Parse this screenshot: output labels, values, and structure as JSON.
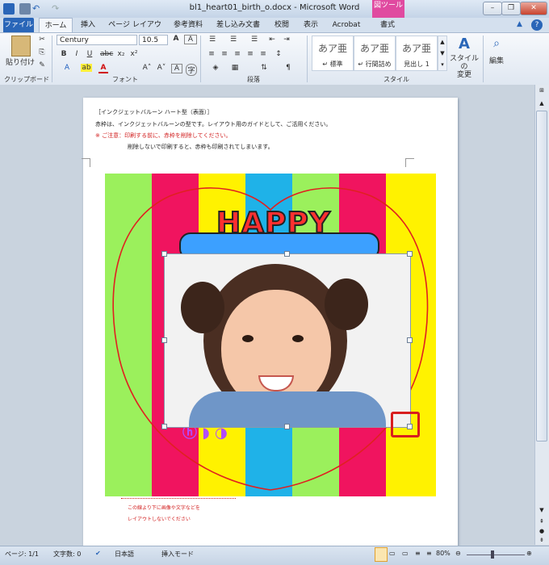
{
  "window": {
    "title": "bl1_heart01_birth_o.docx - Microsoft Word",
    "context_tab": "図ツール",
    "accent": "#2a66b8"
  },
  "tabs": [
    "ファイル",
    "ホーム",
    "挿入",
    "ページ レイアウト",
    "参考資料",
    "差し込み文書",
    "校閲",
    "表示",
    "Acrobat",
    "書式"
  ],
  "ribbon": {
    "clipboard": {
      "label": "クリップボード",
      "paste": "貼り付け"
    },
    "font": {
      "label": "フォント",
      "name": "Century",
      "size": "10.5"
    },
    "paragraph": {
      "label": "段落"
    },
    "styles": {
      "label": "スタイル",
      "items": [
        {
          "glyph": "あア亜",
          "name": "↵ 標準"
        },
        {
          "glyph": "あア亜",
          "name": "↵ 行間詰め"
        },
        {
          "glyph": "あア亜",
          "name": "見出し 1"
        }
      ],
      "change": "スタイルの\n変更"
    },
    "edit": {
      "label": "編集"
    }
  },
  "document": {
    "lines": [
      {
        "text": "［インクジェットバルーン ハート型（表面）］",
        "color": "#222"
      },
      {
        "text": "赤枠は、インクジェットバルーンの型です。レイアウト用のガイドとして、ご活用ください。",
        "color": "#222"
      },
      {
        "text": "※ ご注意：印刷する前に、赤枠を削除してください。",
        "color": "#d22020"
      },
      {
        "text": "削除しないで印刷すると、赤枠も印刷されてしまいます。",
        "color": "#222"
      }
    ],
    "graphic_text": "HAPPY",
    "notes": [
      "この線より下に画像や文字などを",
      "レイアウトしないでください"
    ],
    "stripe_colors": [
      "#9bf05c",
      "#f0145f",
      "#fff200",
      "#1fb2e8",
      "#9bf05c",
      "#f0145f",
      "#fff200"
    ]
  },
  "status": {
    "page": "ページ: 1/1",
    "words": "文字数: 0",
    "language": "日本語",
    "mode": "挿入モード",
    "zoom": "80%"
  }
}
